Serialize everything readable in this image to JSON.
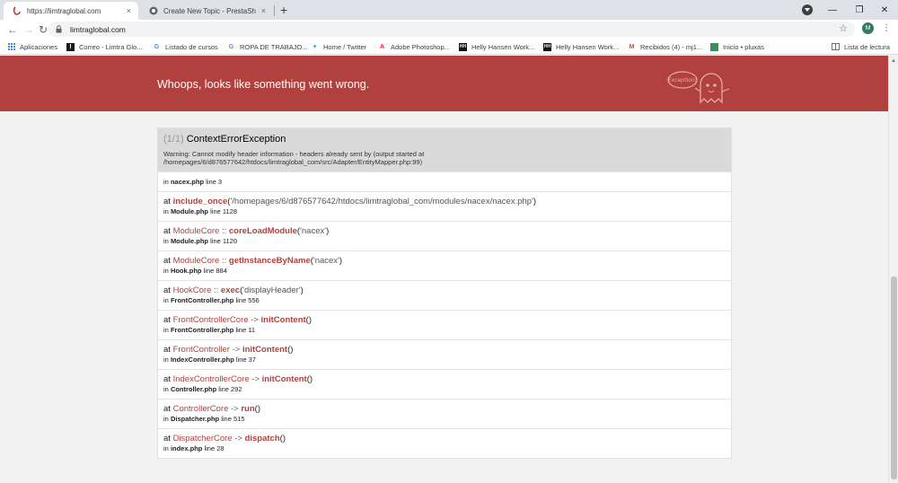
{
  "browser": {
    "tabs": [
      {
        "title": "https://limtraglobal.com",
        "close": "×"
      },
      {
        "title": "Create New Topic - PrestaShop F",
        "close": "×"
      }
    ],
    "new_tab": "+",
    "window_controls": {
      "minimize": "—",
      "restore": "❐",
      "close": "✕"
    },
    "url": "limtraglobal.com",
    "profile_initial": "M",
    "bookmarks": [
      {
        "label": "Aplicaciones",
        "icon": "apps-grid-icon"
      },
      {
        "label": "Correo - Limtra Glo...",
        "icon": "mail-icon"
      },
      {
        "label": "Listado de cursos",
        "icon": "google-icon"
      },
      {
        "label": "ROPA DE TRABAJO...",
        "icon": "google-icon"
      },
      {
        "label": "Home / Twitter",
        "icon": "twitter-icon"
      },
      {
        "label": "Adobe Photoshop...",
        "icon": "adobe-icon"
      },
      {
        "label": "Helly Hansen Work...",
        "icon": "hh-icon"
      },
      {
        "label": "Helly Hansen Work...",
        "icon": "hh-icon"
      },
      {
        "label": "Recibidos (4) - mj1...",
        "icon": "gmail-icon"
      },
      {
        "label": "Inicio • pluxas",
        "icon": "page-icon"
      }
    ],
    "reading_list": "Lista de lectura"
  },
  "page": {
    "banner_title": "Whoops, looks like something went wrong.",
    "ghost_label": "Exception!",
    "exception": {
      "count": "(1/1)",
      "name": "ContextErrorException",
      "message_line1": "Warning: Cannot modify header information - headers already sent by (output started at",
      "message_line2": "/homepages/6/d876577642/htdocs/limtraglobal_com/src/Adapter/EntityMapper.php:99)"
    },
    "first_location": {
      "prefix": "in",
      "file": "nacex.php",
      "line": "line 3"
    },
    "trace": [
      {
        "at": "at",
        "cls": "",
        "sep": "",
        "fn": "include_once",
        "open": "(",
        "arg": "'/homepages/6/d876577642/htdocs/limtraglobal_com/modules/nacex/nacex.php'",
        "close": ")",
        "in": "in",
        "file": "Module.php",
        "line": "line 1128"
      },
      {
        "at": "at",
        "cls": "ModuleCore",
        "sep": "::",
        "fn": "coreLoadModule",
        "open": "(",
        "arg": "'nacex'",
        "close": ")",
        "in": "in",
        "file": "Module.php",
        "line": "line 1120"
      },
      {
        "at": "at",
        "cls": "ModuleCore",
        "sep": "::",
        "fn": "getInstanceByName",
        "open": "(",
        "arg": "'nacex'",
        "close": ")",
        "in": "in",
        "file": "Hook.php",
        "line": "line 884"
      },
      {
        "at": "at",
        "cls": "HookCore",
        "sep": "::",
        "fn": "exec",
        "open": "(",
        "arg": "'displayHeader'",
        "close": ")",
        "in": "in",
        "file": "FrontController.php",
        "line": "line 556"
      },
      {
        "at": "at",
        "cls": "FrontControllerCore",
        "sep": "->",
        "fn": "initContent",
        "open": "(",
        "arg": "",
        "close": ")",
        "in": "in",
        "file": "FrontController.php",
        "line": "line 11"
      },
      {
        "at": "at",
        "cls": "FrontController",
        "sep": "->",
        "fn": "initContent",
        "open": "(",
        "arg": "",
        "close": ")",
        "in": "in",
        "file": "IndexController.php",
        "line": "line 37"
      },
      {
        "at": "at",
        "cls": "IndexControllerCore",
        "sep": "->",
        "fn": "initContent",
        "open": "(",
        "arg": "",
        "close": ")",
        "in": "in",
        "file": "Controller.php",
        "line": "line 292"
      },
      {
        "at": "at",
        "cls": "ControllerCore",
        "sep": "->",
        "fn": "run",
        "open": "(",
        "arg": "",
        "close": ")",
        "in": "in",
        "file": "Dispatcher.php",
        "line": "line 515"
      },
      {
        "at": "at",
        "cls": "DispatcherCore",
        "sep": "->",
        "fn": "dispatch",
        "open": "(",
        "arg": "",
        "close": ")",
        "in": "in",
        "file": "index.php",
        "line": "line 28"
      }
    ]
  },
  "colors": {
    "banner": "#b0413e",
    "accent": "#b0413e",
    "header_gray": "#dadada",
    "profile": "#2e7d62"
  }
}
